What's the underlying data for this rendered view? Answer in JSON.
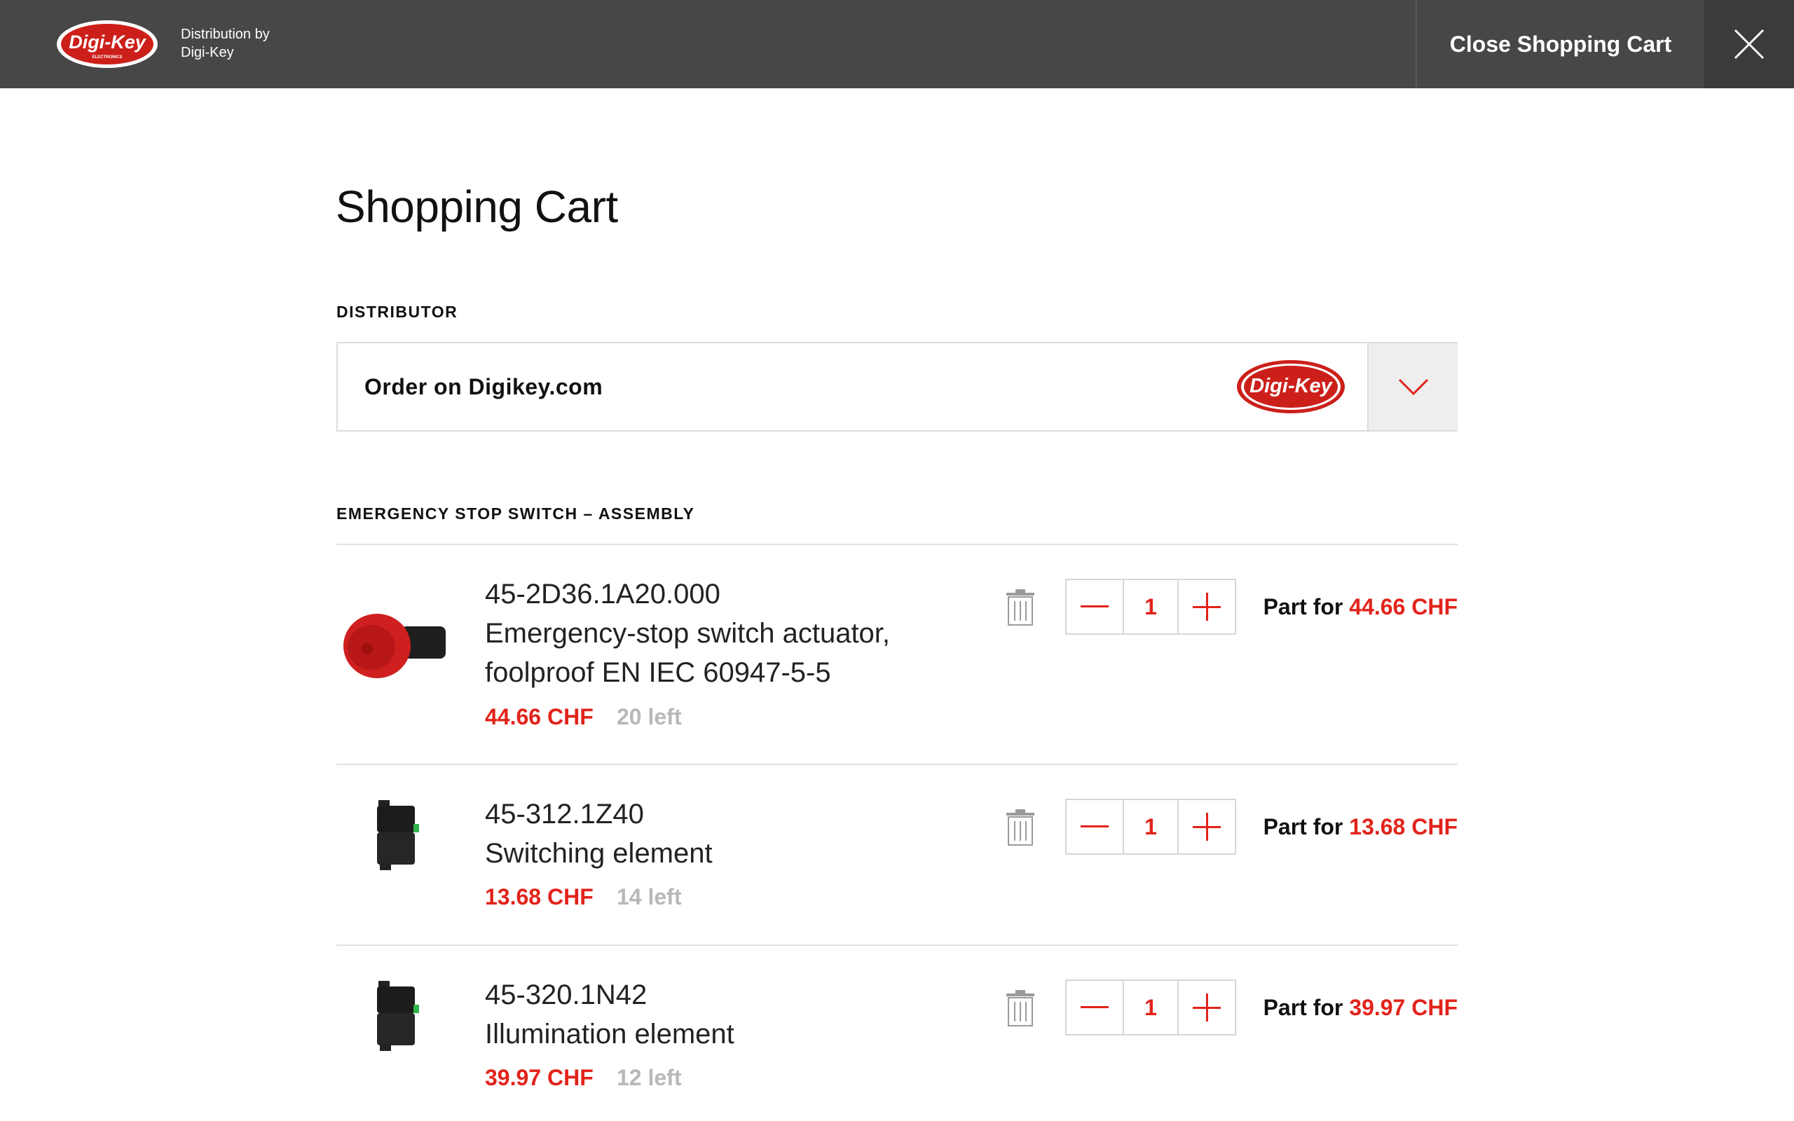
{
  "header": {
    "logo_text": "Digi-Key",
    "logo_subtext": "ELECTRONICS",
    "distribution_line1": "Distribution by",
    "distribution_line2": "Digi-Key",
    "close_label": "Close Shopping Cart"
  },
  "page": {
    "title": "Shopping Cart"
  },
  "distributor": {
    "label": "DISTRIBUTOR",
    "selected": "Order on Digikey.com",
    "logo_text": "Digi-Key"
  },
  "assembly": {
    "title": "EMERGENCY STOP SWITCH – ASSEMBLY",
    "items": [
      {
        "part_no": "45-2D36.1A20.000",
        "desc_line1": "Emergency-stop switch actuator,",
        "desc_line2": "foolproof EN IEC 60947-5-5",
        "price": "44.66 CHF",
        "stock": "20 left",
        "qty": "1",
        "part_for_label": "Part for",
        "part_for_price": "44.66 CHF"
      },
      {
        "part_no": "45-312.1Z40",
        "desc_line1": "Switching element",
        "price": "13.68 CHF",
        "stock": "14 left",
        "qty": "1",
        "part_for_label": "Part for",
        "part_for_price": "13.68 CHF"
      },
      {
        "part_no": "45-320.1N42",
        "desc_line1": "Illumination element",
        "price": "39.97 CHF",
        "stock": "12 left",
        "qty": "1",
        "part_for_label": "Part for",
        "part_for_price": "39.97 CHF"
      }
    ]
  },
  "colors": {
    "header_bg": "#474747",
    "accent_red": "#e2231a",
    "muted_gray": "#b8b8b8"
  },
  "icons": [
    "digikey-logo",
    "close-icon",
    "chevron-down-icon",
    "trash-icon",
    "minus-icon",
    "plus-icon"
  ]
}
